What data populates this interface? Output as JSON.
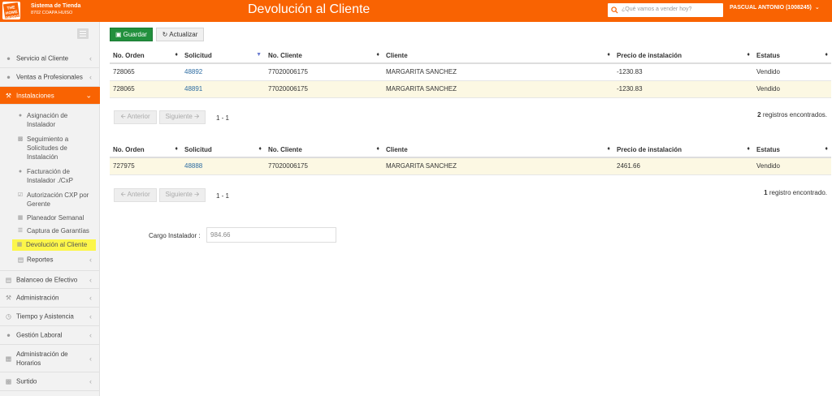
{
  "header": {
    "logo_text": "THE HOME DEPOT",
    "system_title": "Sistema de Tienda",
    "store_name": "8702 COAPA HUISO",
    "page_title": "Devolución al Cliente",
    "search_placeholder": "¿Qué vamos a vender hoy?",
    "user_name": "PASCUAL ANTONIO (1008245)",
    "brand_color": "#f96302"
  },
  "sidebar": {
    "items": [
      {
        "label": "Servicio al Cliente",
        "icon": "user-icon"
      },
      {
        "label": "Ventas a Profesionales",
        "icon": "user-icon"
      },
      {
        "label": "Instalaciones",
        "icon": "wrench-icon",
        "active": true
      },
      {
        "label": "Reportes",
        "icon": "file-icon"
      },
      {
        "label": "Balanceo de Efectivo",
        "icon": "money-icon"
      },
      {
        "label": "Administración",
        "icon": "wrench-icon"
      },
      {
        "label": "Tiempo y Asistencia",
        "icon": "clock-icon"
      },
      {
        "label": "Gestión Laboral",
        "icon": "users-icon"
      },
      {
        "label": "Administración de Horarios",
        "icon": "calendar-icon"
      },
      {
        "label": "Surtido",
        "icon": "truck-icon"
      }
    ],
    "subitems": [
      {
        "label": "Asignación de Instalador",
        "icon": "user-icon"
      },
      {
        "label": "Seguimiento a Solicitudes de Instalación",
        "icon": "folder-icon"
      },
      {
        "label": "Facturación de Instalador ./CxP",
        "icon": "user-icon"
      },
      {
        "label": "Autorización CXP por Gerente",
        "icon": "check-square-icon"
      },
      {
        "label": "Planeador Semanal",
        "icon": "calendar-icon"
      },
      {
        "label": "Captura de Garantías",
        "icon": "list-icon"
      },
      {
        "label": "Devolución al Cliente",
        "icon": "refund-icon",
        "highlighted": true
      }
    ]
  },
  "toolbar": {
    "save_label": "Guardar",
    "refresh_label": "Actualizar"
  },
  "table1": {
    "columns": [
      "No. Orden",
      "Solicitud",
      "No. Cliente",
      "Cliente",
      "Precio de instalación",
      "Estatus"
    ],
    "rows": [
      [
        "728065",
        "48892",
        "77020006175",
        "MARGARITA SANCHEZ",
        "-1230.83",
        "Vendido"
      ],
      [
        "728065",
        "48891",
        "77020006175",
        "MARGARITA SANCHEZ",
        "-1230.83",
        "Vendido"
      ]
    ],
    "prev_label": "Anterior",
    "next_label": "Siguiente",
    "page_info": "1 - 1",
    "records_count": "2",
    "records_text": "registros encontrados."
  },
  "table2": {
    "columns": [
      "No. Orden",
      "Solicitud",
      "No. Cliente",
      "Cliente",
      "Precio de instalación",
      "Estatus"
    ],
    "rows": [
      [
        "727975",
        "48888",
        "77020006175",
        "MARGARITA SANCHEZ",
        "2461.66",
        "Vendido"
      ]
    ],
    "prev_label": "Anterior",
    "next_label": "Siguiente",
    "page_info": "1 - 1",
    "records_count": "1",
    "records_text": "registro encontrado."
  },
  "cargo": {
    "label": "Cargo Instalador :",
    "value": "984.66"
  }
}
